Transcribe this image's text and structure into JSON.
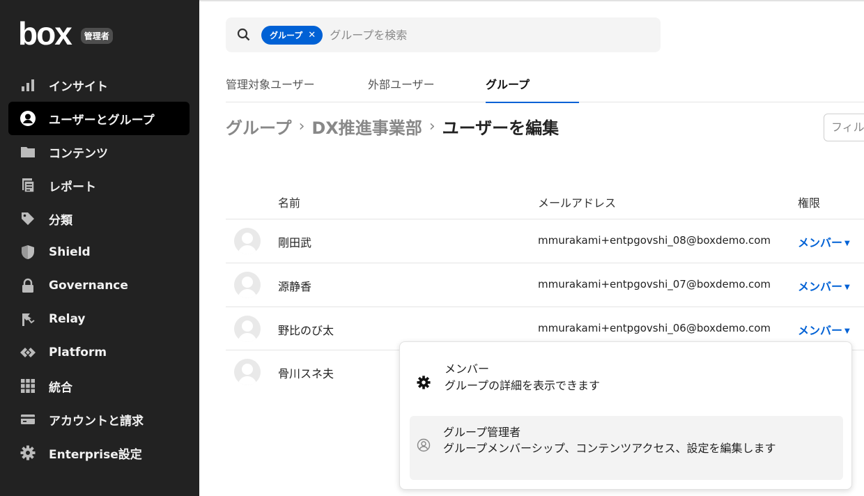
{
  "sidebar": {
    "logo": "box",
    "admin_badge": "管理者",
    "items": [
      {
        "label": "インサイト",
        "icon": "bar-chart-icon"
      },
      {
        "label": "ユーザーとグループ",
        "icon": "user-circle-icon",
        "active": true
      },
      {
        "label": "コンテンツ",
        "icon": "folder-icon"
      },
      {
        "label": "レポート",
        "icon": "report-icon"
      },
      {
        "label": "分類",
        "icon": "tag-icon"
      },
      {
        "label": "Shield",
        "icon": "shield-icon"
      },
      {
        "label": "Governance",
        "icon": "lock-icon"
      },
      {
        "label": "Relay",
        "icon": "relay-icon"
      },
      {
        "label": "Platform",
        "icon": "platform-icon"
      },
      {
        "label": "統合",
        "icon": "grid-icon"
      },
      {
        "label": "アカウントと請求",
        "icon": "credit-card-icon"
      },
      {
        "label": "Enterprise設定",
        "icon": "gear-icon"
      }
    ]
  },
  "search": {
    "chip_label": "グループ",
    "placeholder": "グループを検索"
  },
  "tabs": [
    {
      "label": "管理対象ユーザー"
    },
    {
      "label": "外部ユーザー"
    },
    {
      "label": "グループ",
      "active": true
    }
  ],
  "breadcrumb": [
    "グループ",
    "DX推進事業部",
    "ユーザーを編集"
  ],
  "filter_placeholder": "フィルタ",
  "table": {
    "headers": {
      "name": "名前",
      "email": "メールアドレス",
      "role": "権限"
    },
    "rows": [
      {
        "name": "剛田武",
        "email": "mmurakami+entpgovshi_08@boxdemo.com",
        "role": "メンバー"
      },
      {
        "name": "源静香",
        "email": "mmurakami+entpgovshi_07@boxdemo.com",
        "role": "メンバー"
      },
      {
        "name": "野比のび太",
        "email": "mmurakami+entpgovshi_06@boxdemo.com",
        "role": "メンバー"
      },
      {
        "name": "骨川スネ夫",
        "email": "",
        "role": ""
      }
    ]
  },
  "dropdown": {
    "items": [
      {
        "title": "メンバー",
        "description": "グループの詳細を表示できます",
        "icon": "gear-icon"
      },
      {
        "title": "グループ管理者",
        "description": "グループメンバーシップ、コンテンツアクセス、設定を編集します",
        "icon": "user-circle-icon"
      }
    ]
  },
  "colors": {
    "accent": "#0061d5",
    "sidebar_bg": "#222222"
  }
}
